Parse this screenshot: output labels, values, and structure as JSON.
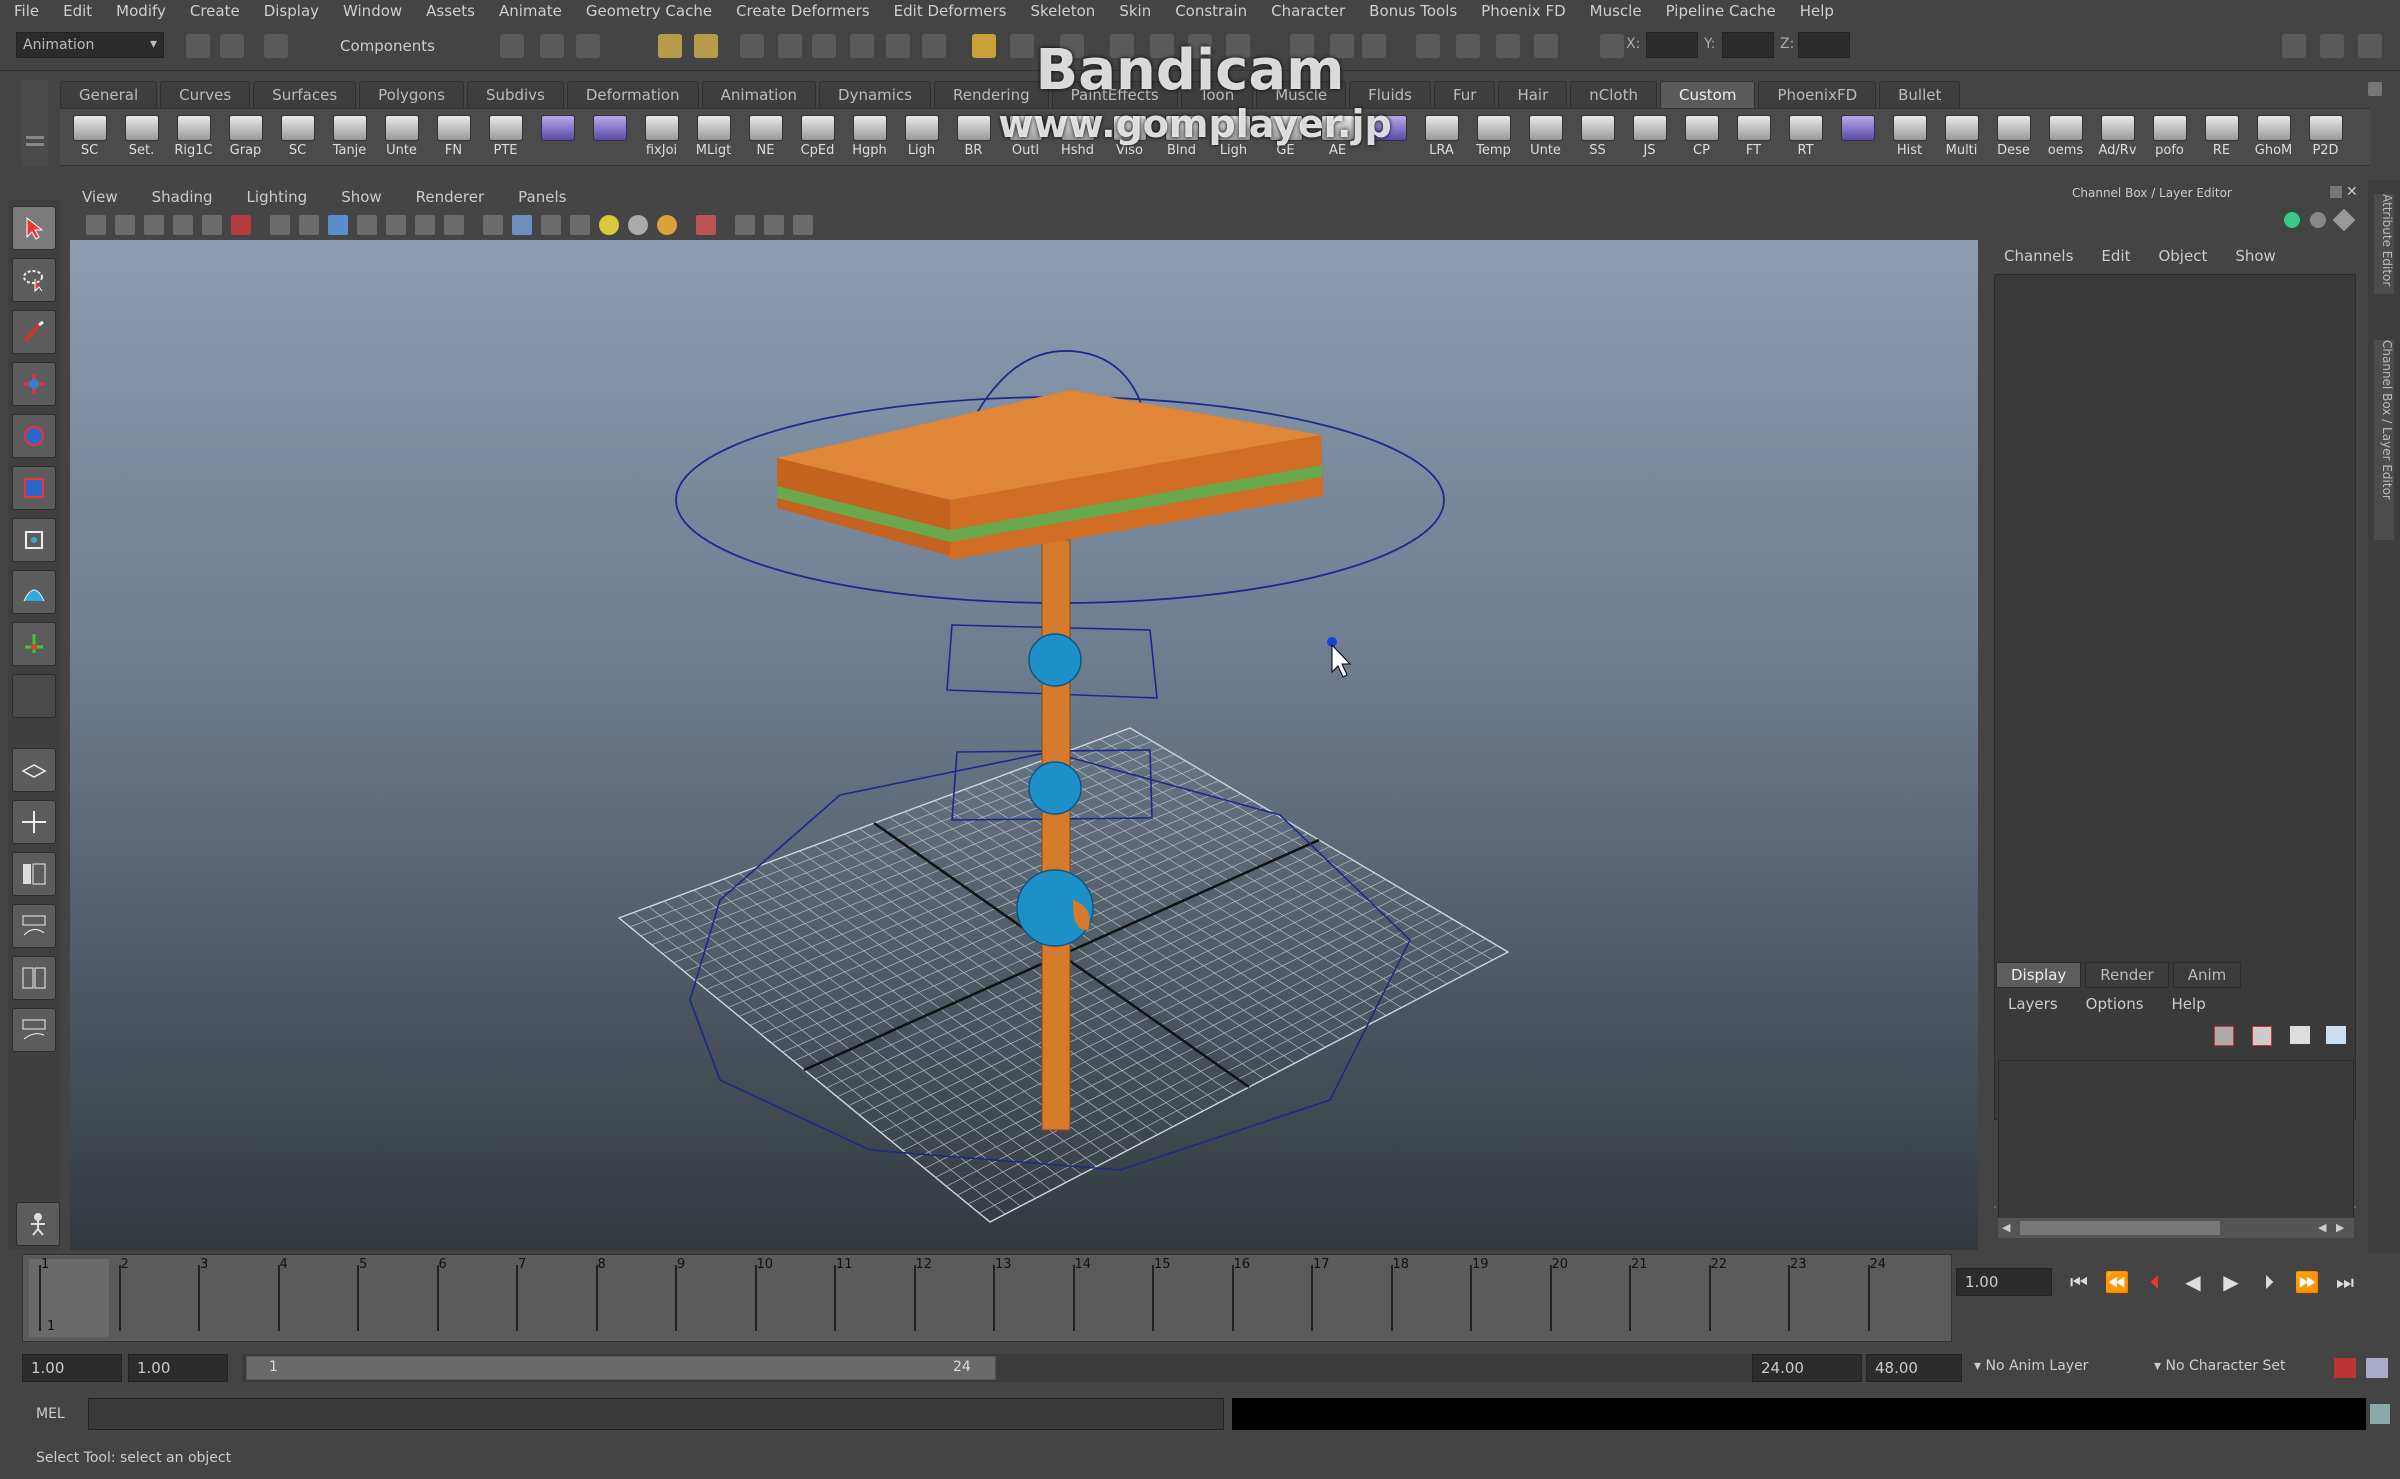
{
  "menubar": [
    "File",
    "Edit",
    "Modify",
    "Create",
    "Display",
    "Window",
    "Assets",
    "Animate",
    "Geometry Cache",
    "Create Deformers",
    "Edit Deformers",
    "Skeleton",
    "Skin",
    "Constrain",
    "Character",
    "Bonus Tools",
    "Phoenix FD",
    "Muscle",
    "Pipeline Cache",
    "Help"
  ],
  "statusline": {
    "mode": "Animation",
    "components": "Components",
    "x_label": "X:",
    "y_label": "Y:",
    "z_label": "Z:"
  },
  "shelf_tabs": [
    "General",
    "Curves",
    "Surfaces",
    "Polygons",
    "Subdivs",
    "Deformation",
    "Animation",
    "Dynamics",
    "Rendering",
    "PaintEffects",
    "Toon",
    "Muscle",
    "Fluids",
    "Fur",
    "Hair",
    "nCloth",
    "Custom",
    "PhoenixFD",
    "Bullet"
  ],
  "active_shelf_tab": "Custom",
  "shelf_items": [
    "SC",
    "Set.",
    "Rig1C",
    "Grap",
    "SC",
    "Tanje",
    "Unte",
    "FN",
    "PTE",
    "",
    "",
    "fixJoi",
    "MLigt",
    "NE",
    "CpEd",
    "Hgph",
    "Ligh",
    "BR",
    "Outl",
    "Hshd",
    "Viso",
    "Blnd",
    "Ligh",
    "GE",
    "AE",
    "",
    "LRA",
    "Temp",
    "Unte",
    "SS",
    "JS",
    "CP",
    "FT",
    "RT",
    "",
    "Hist",
    "Multi",
    "Dese",
    "oems",
    "Ad/Rv",
    "pofo",
    "RE",
    "GhoM",
    "P2D"
  ],
  "watermark": {
    "line1": "Bandicam",
    "line2": "www.gomplayer.jp"
  },
  "viewport_menu": [
    "View",
    "Shading",
    "Lighting",
    "Show",
    "Renderer",
    "Panels"
  ],
  "channel_box": {
    "title": "Channel Box / Layer Editor",
    "menu": [
      "Channels",
      "Edit",
      "Object",
      "Show"
    ],
    "layer_tabs": [
      "Display",
      "Render",
      "Anim"
    ],
    "active_layer_tab": "Display",
    "layer_menu": [
      "Layers",
      "Options",
      "Help"
    ],
    "side_tabs": [
      "Attribute Editor",
      "Channel Box / Layer Editor"
    ]
  },
  "timeline": {
    "frames": [
      "1",
      "2",
      "3",
      "4",
      "5",
      "6",
      "7",
      "8",
      "9",
      "10",
      "11",
      "12",
      "13",
      "14",
      "15",
      "16",
      "17",
      "18",
      "19",
      "20",
      "21",
      "22",
      "23",
      "24"
    ],
    "current_frame": "1",
    "current_time": "1.00"
  },
  "range": {
    "start": "1.00",
    "playback_start": "1.00",
    "slider_start": "1",
    "slider_end": "24",
    "playback_end": "24.00",
    "end": "48.00",
    "anim_layer": "No Anim Layer",
    "character_set": "No Character Set"
  },
  "command_line": {
    "label": "MEL"
  },
  "help_line": "Select Tool: select an object",
  "colors": {
    "accent_tab": "#5a5a5a",
    "box_orange": "#d2691e",
    "stripe_green": "#6aa84f",
    "joint_blue": "#1e90c8",
    "curve_blue": "#1a237e"
  }
}
